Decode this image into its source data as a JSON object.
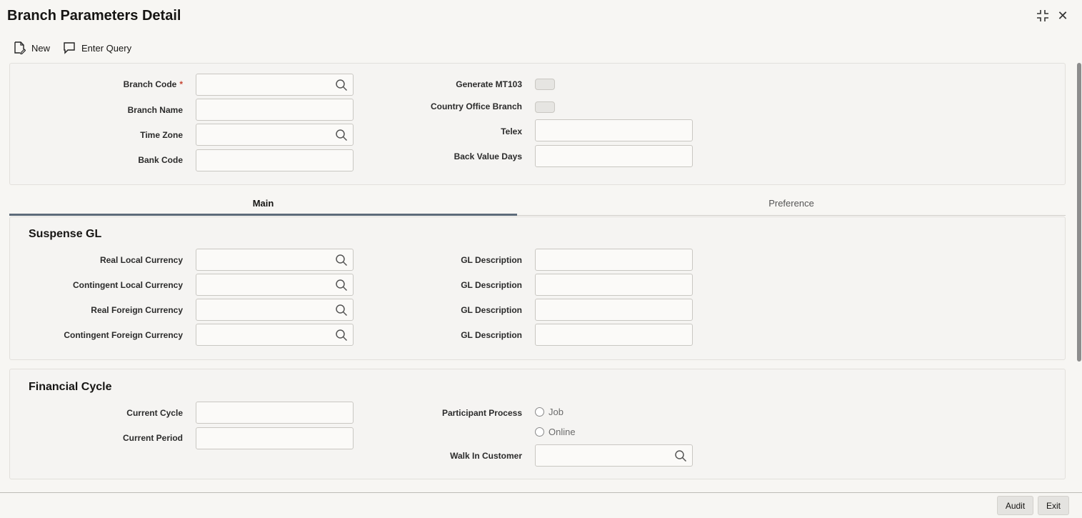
{
  "window": {
    "title": "Branch Parameters Detail",
    "controls": [
      {
        "icon": "restore-icon"
      },
      {
        "icon": "close-icon",
        "label": "✕"
      }
    ]
  },
  "toolbar": {
    "new_label": "New",
    "enter_query_label": "Enter Query"
  },
  "header_form": {
    "branch_code": {
      "label": "Branch Code",
      "required_mark": "*",
      "value": ""
    },
    "branch_name": {
      "label": "Branch Name",
      "value": ""
    },
    "time_zone": {
      "label": "Time Zone",
      "value": ""
    },
    "bank_code": {
      "label": "Bank Code",
      "value": ""
    },
    "generate_mt103": {
      "label": "Generate MT103",
      "checked": false
    },
    "country_office_branch": {
      "label": "Country Office Branch",
      "checked": false
    },
    "telex": {
      "label": "Telex",
      "value": ""
    },
    "back_value_days": {
      "label": "Back Value Days",
      "value": ""
    }
  },
  "tabs": [
    {
      "label": "Main",
      "active": true
    },
    {
      "label": "Preference",
      "active": false
    }
  ],
  "suspense_gl": {
    "title": "Suspense GL",
    "rows": [
      {
        "label": "Real Local Currency",
        "desc_label": "GL Description"
      },
      {
        "label": "Contingent Local Currency",
        "desc_label": "GL Description"
      },
      {
        "label": "Real Foreign Currency",
        "desc_label": "GL Description"
      },
      {
        "label": "Contingent Foreign Currency",
        "desc_label": "GL Description"
      }
    ]
  },
  "financial_cycle": {
    "title": "Financial Cycle",
    "current_cycle_label": "Current Cycle",
    "current_period_label": "Current Period",
    "participant_process_label": "Participant Process",
    "options": [
      "Job",
      "Online"
    ],
    "walk_in_customer_label": "Walk In Customer"
  },
  "footer": {
    "audit_label": "Audit",
    "exit_label": "Exit"
  }
}
